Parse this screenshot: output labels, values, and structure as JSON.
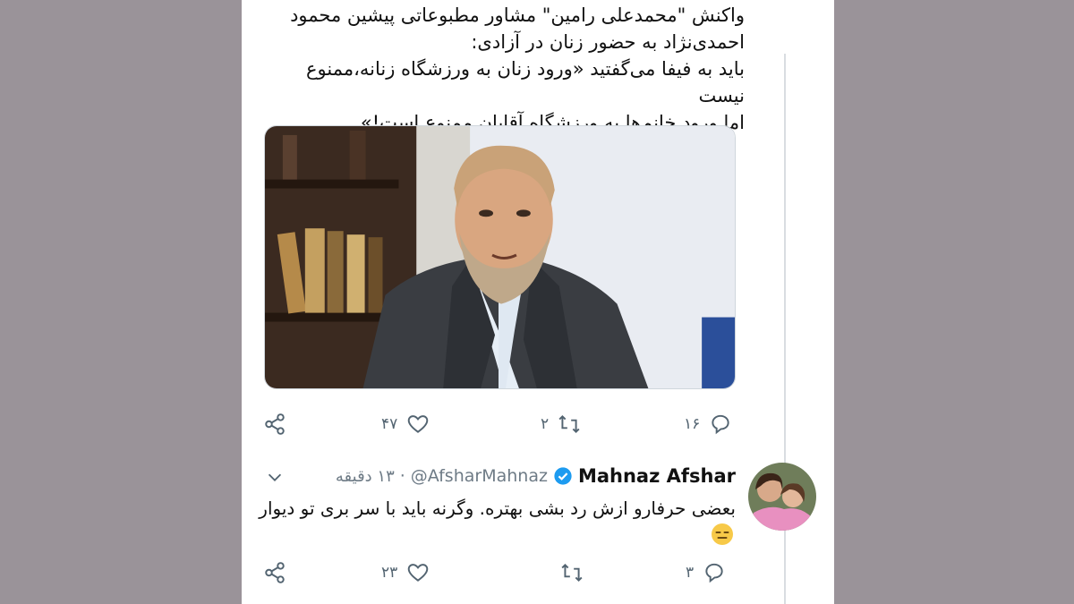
{
  "tweet": {
    "text_line1": "واکنش \"محمدعلی رامین\" مشاور مطبوعاتی پیشین محمود",
    "text_line2": "احمدی‌نژاد به حضور زنان در آزادی:",
    "text_line3": "باید به فیفا می‌گفتید «ورود زنان به ورزشگاه زنانه،ممنوع نیست",
    "text_line4": "اما ورود خانم‌ها به ورزشگاه آقایان ممنوع است!»",
    "actions": {
      "replies": "۱۶",
      "retweets": "۲",
      "likes": "۴۷"
    }
  },
  "reply": {
    "name": "Mahnaz Afshar",
    "handle": "@AfsharMahnaz",
    "separator": "·",
    "time": "۱۳ دقیقه",
    "text": "بعضی حرفارو ازش رد بشی بهتره. وگرنه باید با سر بری تو دیوار",
    "actions": {
      "replies": "۳",
      "retweets": "",
      "likes": "۲۳"
    }
  },
  "icons": {
    "reply": "speech-bubble-icon",
    "retweet": "retweet-icon",
    "like": "heart-icon",
    "share": "share-icon",
    "verified": "verified-badge-icon",
    "menu": "chevron-down-icon",
    "emoji": "expressionless-face-emoji"
  },
  "colors": {
    "background": "#9a9399",
    "panel": "#ffffff",
    "icon": "#536471",
    "verified": "#1d9bf0"
  }
}
